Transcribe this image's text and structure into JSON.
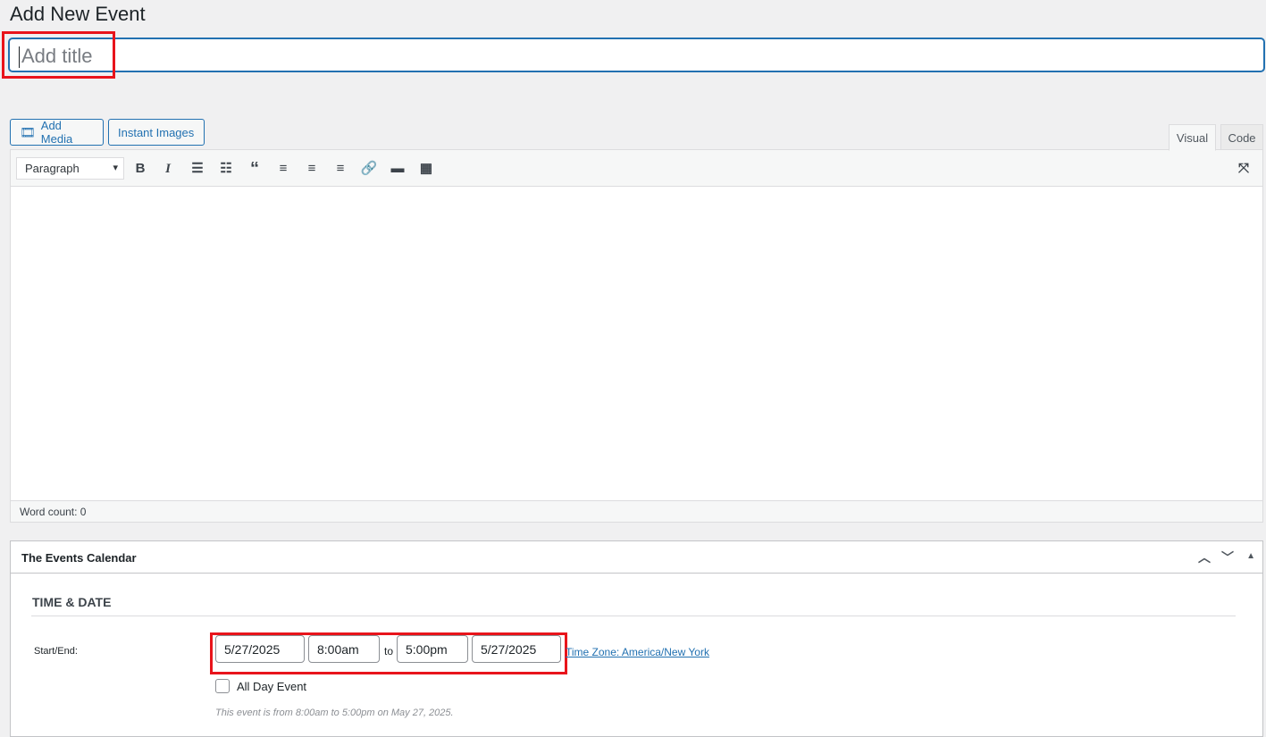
{
  "page": {
    "title": "Add New Event",
    "title_placeholder": "Add title"
  },
  "media": {
    "add_media": "Add Media",
    "instant_images": "Instant Images"
  },
  "editor": {
    "tabs": [
      "Visual",
      "Code"
    ],
    "format": "Paragraph",
    "word_count": "Word count: 0"
  },
  "metabox": {
    "title": "The Events Calendar",
    "section": "TIME & DATE",
    "start_end_label": "Start/End:",
    "start_date": "5/27/2025",
    "start_time": "8:00am",
    "to": "to",
    "end_time": "5:00pm",
    "end_date": "5/27/2025",
    "timezone": "Time Zone: America/New York",
    "all_day": "All Day Event",
    "summary": "This event is from 8:00am to 5:00pm on May 27, 2025."
  },
  "colors": {
    "accent": "#2271b1",
    "highlight": "#e8141b"
  }
}
